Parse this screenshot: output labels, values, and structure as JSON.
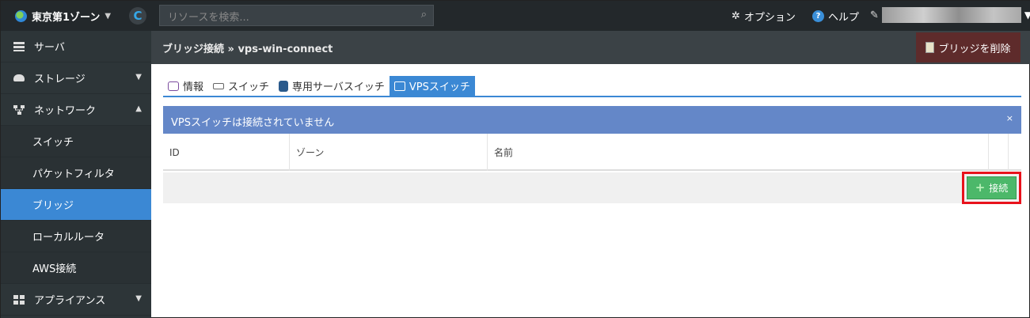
{
  "topbar": {
    "zone": "東京第1ゾーン",
    "search_placeholder": "リソースを検索...",
    "options_label": "オプション",
    "help_label": "ヘルプ"
  },
  "sidebar": {
    "items": [
      {
        "label": "サーバ"
      },
      {
        "label": "ストレージ"
      },
      {
        "label": "ネットワーク"
      },
      {
        "label": "スイッチ"
      },
      {
        "label": "パケットフィルタ"
      },
      {
        "label": "ブリッジ"
      },
      {
        "label": "ローカルルータ"
      },
      {
        "label": "AWS接続"
      },
      {
        "label": "アプライアンス"
      }
    ]
  },
  "header": {
    "breadcrumb": "ブリッジ接続 » vps-win-connect",
    "delete_button": "ブリッジを削除"
  },
  "tabs": [
    {
      "label": "情報"
    },
    {
      "label": "スイッチ"
    },
    {
      "label": "専用サーバスイッチ"
    },
    {
      "label": "VPSスイッチ"
    }
  ],
  "alert": {
    "message": "VPSスイッチは接続されていません",
    "close": "×"
  },
  "table": {
    "columns": [
      "ID",
      "ゾーン",
      "名前"
    ]
  },
  "actions": {
    "connect_button": "接続"
  },
  "colors": {
    "accent": "#3b88d4",
    "alert": "#6487c8",
    "success": "#4cb86a",
    "danger": "#5e2b2b",
    "highlight": "#e8121c"
  }
}
